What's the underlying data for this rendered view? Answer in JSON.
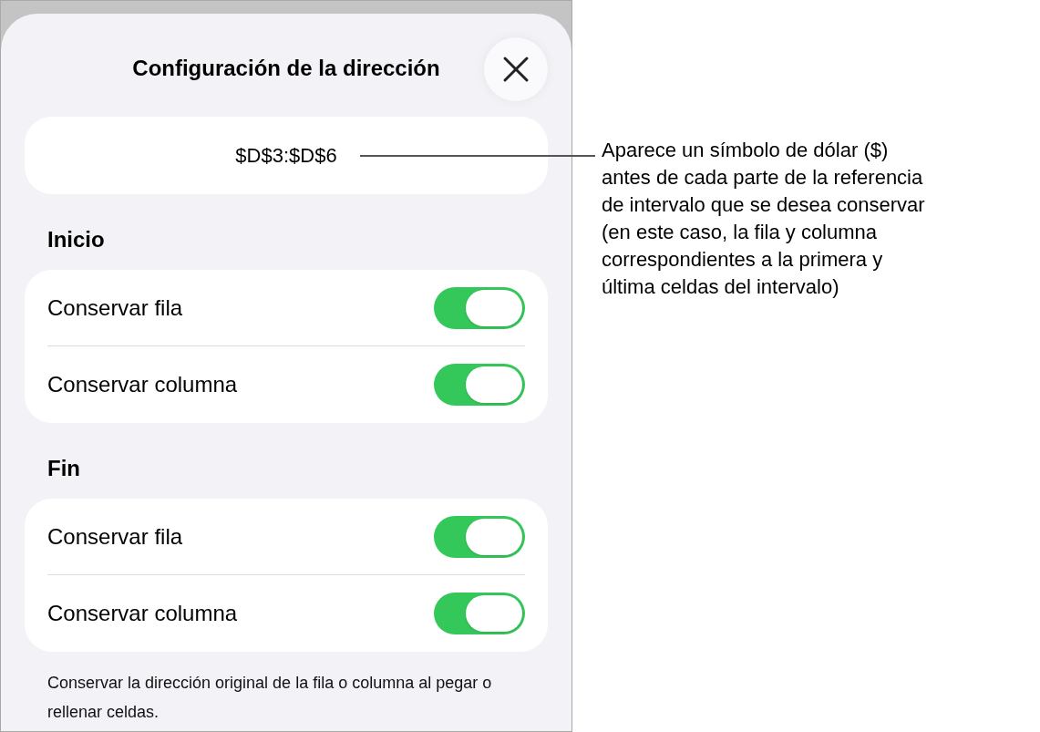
{
  "sheet": {
    "title": "Configuración de la dirección",
    "reference": "$D$3:$D$6"
  },
  "sections": [
    {
      "heading": "Inicio",
      "rows": [
        {
          "label": "Conservar fila",
          "on": true
        },
        {
          "label": "Conservar columna",
          "on": true
        }
      ]
    },
    {
      "heading": "Fin",
      "rows": [
        {
          "label": "Conservar fila",
          "on": true
        },
        {
          "label": "Conservar columna",
          "on": true
        }
      ]
    }
  ],
  "footer": "Conservar la dirección original de la fila o columna al pegar o rellenar celdas.",
  "callout": [
    "Aparece un símbolo de dólar ($)",
    "antes de cada parte de la referencia",
    "de intervalo que se desea conservar",
    "(en este caso, la fila y columna",
    "correspondientes a la primera y",
    "última celdas del intervalo)"
  ]
}
